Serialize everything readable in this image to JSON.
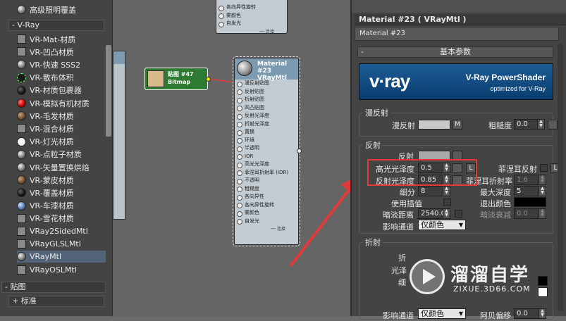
{
  "browser": {
    "top_item": "高级照明覆盖",
    "vray_group": "- V-Ray",
    "materials": [
      {
        "label": "VR-Mat-材质",
        "swatch": "gray"
      },
      {
        "label": "VR-凹凸材质",
        "swatch": "gray"
      },
      {
        "label": "VR-快速 SSS2",
        "swatch": "sphere"
      },
      {
        "label": "VR-散布体积",
        "swatch": "grid"
      },
      {
        "label": "VR-材质包裹器",
        "swatch": "black"
      },
      {
        "label": "VR-模拟有机材质",
        "swatch": "red"
      },
      {
        "label": "VR-毛发材质",
        "swatch": "brown"
      },
      {
        "label": "VR-混合材质",
        "swatch": "gray"
      },
      {
        "label": "VR-灯光材质",
        "swatch": "white"
      },
      {
        "label": "VR-点粒子材质",
        "swatch": "sphere"
      },
      {
        "label": "VR-矢量置换烘焙",
        "swatch": "sphere"
      },
      {
        "label": "VR-蒙皮材质",
        "swatch": "brown"
      },
      {
        "label": "VR-覆盖材质",
        "swatch": "black"
      },
      {
        "label": "VR-车漆材质",
        "swatch": "blue"
      },
      {
        "label": "VR-雪花材质",
        "swatch": "gray"
      },
      {
        "label": "VRay2SidedMtl",
        "swatch": "gray"
      },
      {
        "label": "VRayGLSLMtl",
        "swatch": "gray"
      },
      {
        "label": "VRayMtl",
        "swatch": "sphere"
      },
      {
        "label": "VRayOSLMtl",
        "swatch": "gray"
      }
    ],
    "selected_index": 17,
    "map_group": "- 贴图",
    "standard_group": "+ 标准"
  },
  "nodes": {
    "top_node_rows": [
      "各向异性旋转",
      "雾颜色",
      "自发光"
    ],
    "top_node_footer": "── 连接",
    "bitmap": {
      "title": "贴图 #47",
      "subtitle": "Bitmap"
    },
    "material": {
      "title": "Material #23",
      "subtitle": "VRayMtl",
      "slots": [
        "漫反射贴图",
        "反射贴图",
        "折射贴图",
        "凹凸贴图",
        "反射光泽度",
        "折射光泽度",
        "置换",
        "环境",
        "半透明",
        "IOR",
        "高光光泽度",
        "菲涅耳折射率 (IOR)",
        "不透明",
        "粗糙度",
        "各向异性",
        "各向异性旋转",
        "雾颜色",
        "自发光"
      ],
      "footer": "── 连接"
    }
  },
  "editor": {
    "title": "Material #23  ( VRayMtl )",
    "name_field": "Material #23",
    "rollout": "基本参数",
    "rollout_pm": "-",
    "banner": {
      "logo": "v·ray",
      "line1": "V-Ray PowerShader",
      "line2": "optimized for V-Ray"
    },
    "diffuse": {
      "group": "漫反射",
      "diffuse_label": "漫反射",
      "map_btn": "M",
      "roughness_label": "粗糙度",
      "roughness_value": "0.0"
    },
    "reflection": {
      "group": "反射",
      "reflect_label": "反射",
      "hilight_label": "高光光泽度",
      "hilight_value": "0.5",
      "lock_btn": "L",
      "refl_gloss_label": "反射光泽度",
      "refl_gloss_value": "0.85",
      "fresnel_label": "菲涅耳反射",
      "fresnel_ior_label": "菲涅耳折射率",
      "fresnel_ior_value": "1.6",
      "fresnel_lock": "L",
      "subdivs_label": "细分",
      "subdivs_value": "8",
      "max_depth_label": "最大深度",
      "max_depth_value": "5",
      "interp_label": "使用插值",
      "exit_color_label": "退出颜色",
      "dim_dist_label": "暗淡距离",
      "dim_dist_value": "2540.0",
      "dim_falloff_label": "暗淡衰减",
      "dim_falloff_value": "0.0",
      "affect_label": "影响通道",
      "affect_value": "仅颜色"
    },
    "refraction": {
      "group": "折射",
      "refract_label": "折",
      "gloss_label": "光泽",
      "subdivs_label": "细",
      "affect_label": "影响通道",
      "affect_value": "仅颜色",
      "abbe_label": "阿贝偏移",
      "abbe_value": "0.0"
    }
  },
  "watermark": {
    "line1": "溜溜自学",
    "line2": "ZIXUE.3D66.COM"
  },
  "colors": {
    "accent_red": "#e23a3a",
    "selection": "#52637a",
    "banner": "#1c5c96",
    "bitmap_node": "#2f7a32"
  }
}
